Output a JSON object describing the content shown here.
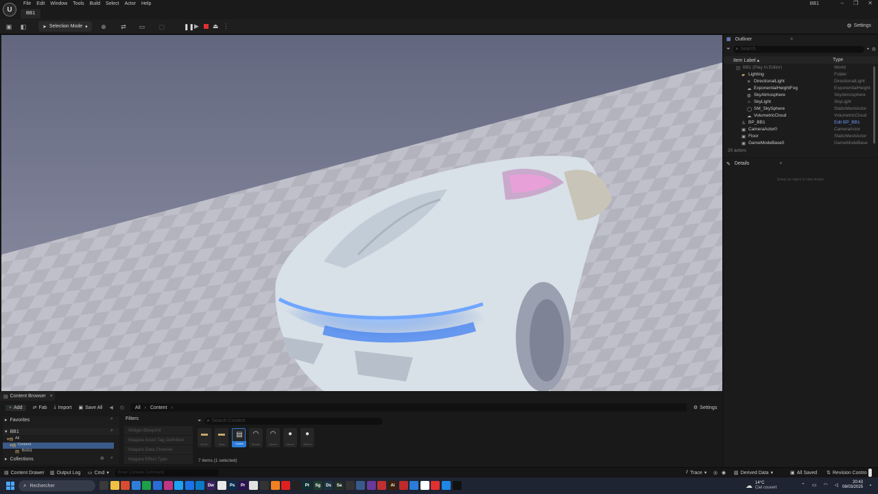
{
  "menu": [
    "File",
    "Edit",
    "Window",
    "Tools",
    "Build",
    "Select",
    "Actor",
    "Help"
  ],
  "level_tab": "BB1",
  "window_title": "BB1",
  "window_controls": [
    "–",
    "❐",
    "✕"
  ],
  "toolbar": {
    "selection_mode": "Selection Mode",
    "settings": "Settings"
  },
  "outliner": {
    "title": "Outliner",
    "search_placeholder": "Search",
    "col_label": "Item Label ▴",
    "col_type": "Type",
    "rows": [
      {
        "label": "BB1 (Play In Editor)",
        "type": "World",
        "indent": 0
      },
      {
        "label": "Lighting",
        "type": "Folder",
        "indent": 1
      },
      {
        "label": "DirectionalLight",
        "type": "DirectionalLight",
        "indent": 2
      },
      {
        "label": "ExponentialHeightFog",
        "type": "ExponentialHeight",
        "indent": 2
      },
      {
        "label": "SkyAtmosphere",
        "type": "SkyAtmosphere",
        "indent": 2
      },
      {
        "label": "SkyLight",
        "type": "SkyLight",
        "indent": 2
      },
      {
        "label": "SM_SkySphere",
        "type": "StaticMeshActor",
        "indent": 2
      },
      {
        "label": "VolumetricCloud",
        "type": "VolumetricCloud",
        "indent": 2
      },
      {
        "label": "BP_BB1",
        "type": "Edit BP_BB1",
        "indent": 1
      },
      {
        "label": "CameraActor0",
        "type": "CameraActor",
        "indent": 1
      },
      {
        "label": "Floor",
        "type": "StaticMeshActor",
        "indent": 1
      },
      {
        "label": "GameModeBase0",
        "type": "GameModeBase",
        "indent": 1
      }
    ],
    "actor_count": "20 actors"
  },
  "details": {
    "title": "Details",
    "empty_hint": "Select an object to view details."
  },
  "content_browser": {
    "tab": "Content Browser",
    "add": "Add",
    "fab": "Fab",
    "import": "Import",
    "save_all": "Save All",
    "breadcrumb": [
      "All",
      "Content"
    ],
    "settings": "Settings",
    "favorites": "Favorites",
    "project": "BB1",
    "tree": [
      "All",
      "Content",
      "BUG1"
    ],
    "collections": "Collections",
    "filters_title": "Filters",
    "filters": [
      "Widget Blueprint",
      "Niagara Asset Tag Definition",
      "Niagara Data Channel",
      "Niagara Effect Type"
    ],
    "search_placeholder": "Search Content",
    "assets": [
      "BUG1",
      "Stats",
      "Cubes",
      "Smoke",
      "Wheel",
      "Wheel",
      "Wheel"
    ],
    "status": "7 items (1 selected)"
  },
  "statusbar": {
    "content_drawer": "Content Drawer",
    "output_log": "Output Log",
    "cmd": "Cmd",
    "console_placeholder": "Enter Console Command",
    "trace": "Trace",
    "derived_data": "Derived Data",
    "all_saved": "All Saved",
    "revision_control": "Revision Contro"
  },
  "taskbar": {
    "search": "Rechercher",
    "weather_temp": "14°C",
    "weather_text": "Ciel couvert",
    "time": "20:43",
    "date": "08/03/2025",
    "apps": [
      {
        "label": "",
        "color": "#3a3a3a"
      },
      {
        "label": "",
        "color": "#f0c040"
      },
      {
        "label": "",
        "color": "#d84c30"
      },
      {
        "label": "",
        "color": "#2f7fd8"
      },
      {
        "label": "",
        "color": "#1e9e4a"
      },
      {
        "label": "",
        "color": "#2b6cd8"
      },
      {
        "label": "",
        "color": "#c13584"
      },
      {
        "label": "",
        "color": "#1da1f2"
      },
      {
        "label": "",
        "color": "#1a73e8"
      },
      {
        "label": "",
        "color": "#0a7ac8"
      },
      {
        "label": "Dw",
        "color": "#3a1f5e"
      },
      {
        "label": "",
        "color": "#e8e8e8"
      },
      {
        "label": "Ps",
        "color": "#0b2b4d"
      },
      {
        "label": "Pr",
        "color": "#2a1050"
      },
      {
        "label": "",
        "color": "#e0e0e0"
      },
      {
        "label": "",
        "color": "#333"
      },
      {
        "label": "",
        "color": "#f08020"
      },
      {
        "label": "",
        "color": "#e02020"
      },
      {
        "label": "",
        "color": "#222"
      },
      {
        "label": "Pt",
        "color": "#0d2f2f"
      },
      {
        "label": "Sg",
        "color": "#1d3d2d"
      },
      {
        "label": "Ds",
        "color": "#1a3340"
      },
      {
        "label": "Sa",
        "color": "#223024"
      },
      {
        "label": "",
        "color": "#333"
      },
      {
        "label": "",
        "color": "#3a5a8a"
      },
      {
        "label": "",
        "color": "#6a3a9a"
      },
      {
        "label": "",
        "color": "#c03030"
      },
      {
        "label": "Ai",
        "color": "#3b1f08"
      },
      {
        "label": "",
        "color": "#c02a2a"
      },
      {
        "label": "",
        "color": "#2a7cd8"
      },
      {
        "label": "",
        "color": "#ffffff"
      },
      {
        "label": "",
        "color": "#e03030"
      },
      {
        "label": "",
        "color": "#1e88e5"
      },
      {
        "label": "",
        "color": "#111"
      }
    ]
  }
}
